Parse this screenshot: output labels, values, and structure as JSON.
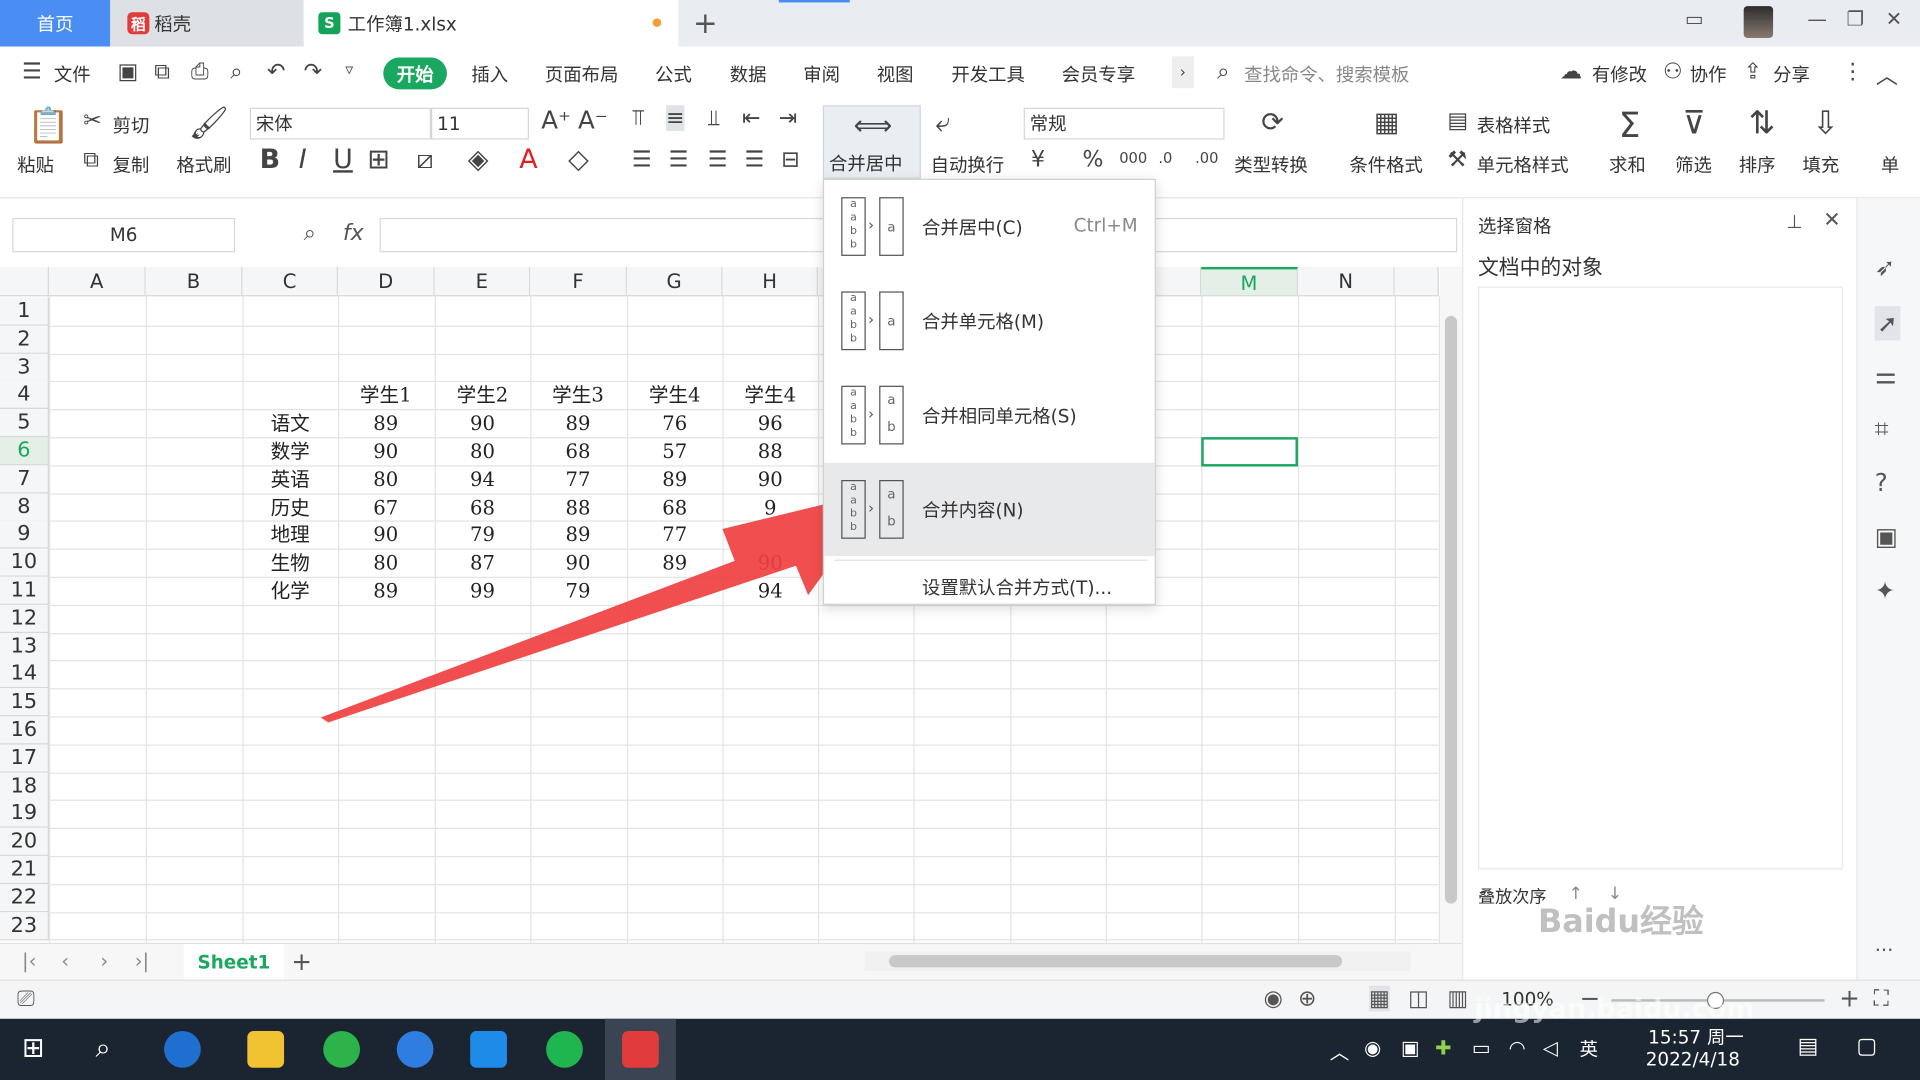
{
  "tabs": {
    "home": "首页",
    "daoke": "稻壳",
    "doc": "工作簿1.xlsx",
    "add": "+"
  },
  "menu": {
    "file": "文件",
    "items": [
      "开始",
      "插入",
      "页面布局",
      "公式",
      "数据",
      "审阅",
      "视图",
      "开发工具",
      "会员专享"
    ],
    "search_placeholder": "查找命令、搜索模板",
    "modified": "有修改",
    "collab": "协作",
    "share": "分享"
  },
  "ribbon": {
    "paste": "粘贴",
    "cut": "剪切",
    "copy": "复制",
    "format_painter": "格式刷",
    "font_name": "宋体",
    "font_size": "11",
    "merge_center": "合并居中",
    "wrap_text": "自动换行",
    "number_format": "常规",
    "type_convert": "类型转换",
    "cond_format": "条件格式",
    "table_style": "表格样式",
    "cell_style": "单元格样式",
    "sum": "求和",
    "filter": "筛选",
    "sort": "排序",
    "fill": "填充",
    "single": "单"
  },
  "formula": {
    "name_box": "M6",
    "fx": "fx"
  },
  "columns": [
    "A",
    "B",
    "C",
    "D",
    "E",
    "F",
    "G",
    "H",
    "M",
    "N"
  ],
  "rows": [
    "1",
    "2",
    "3",
    "4",
    "5",
    "6",
    "7",
    "8",
    "9",
    "10",
    "11",
    "12",
    "13",
    "14",
    "15",
    "16",
    "17",
    "18",
    "19",
    "20",
    "21",
    "22",
    "23"
  ],
  "table": {
    "headers": [
      "学生1",
      "学生2",
      "学生3",
      "学生4",
      "学生4"
    ],
    "subjects": [
      "语文",
      "数学",
      "英语",
      "历史",
      "地理",
      "生物",
      "化学"
    ],
    "values": [
      [
        "89",
        "90",
        "89",
        "76",
        "96"
      ],
      [
        "90",
        "80",
        "68",
        "57",
        "88"
      ],
      [
        "80",
        "94",
        "77",
        "89",
        "90"
      ],
      [
        "67",
        "68",
        "88",
        "68",
        "9"
      ],
      [
        "90",
        "79",
        "89",
        "77",
        ""
      ],
      [
        "80",
        "87",
        "90",
        "89",
        "90"
      ],
      [
        "89",
        "99",
        "79",
        "",
        "94"
      ]
    ]
  },
  "dropdown": {
    "items": [
      {
        "label": "合并居中(C)",
        "shortcut": "Ctrl+M"
      },
      {
        "label": "合并单元格(M)",
        "shortcut": ""
      },
      {
        "label": "合并相同单元格(S)",
        "shortcut": ""
      },
      {
        "label": "合并内容(N)",
        "shortcut": ""
      }
    ],
    "default_setting": "设置默认合并方式(T)..."
  },
  "panel": {
    "title": "选择窗格",
    "subtitle": "文档中的对象",
    "order": "叠放次序"
  },
  "sheet": {
    "name": "Sheet1",
    "zoom": "100%"
  },
  "taskbar": {
    "time": "15:57 周一",
    "date": "2022/4/18",
    "ime": "英"
  },
  "colors": {
    "accent_green": "#1aa760",
    "tab_blue": "#4a8df3",
    "arrow_red": "#f04040"
  }
}
